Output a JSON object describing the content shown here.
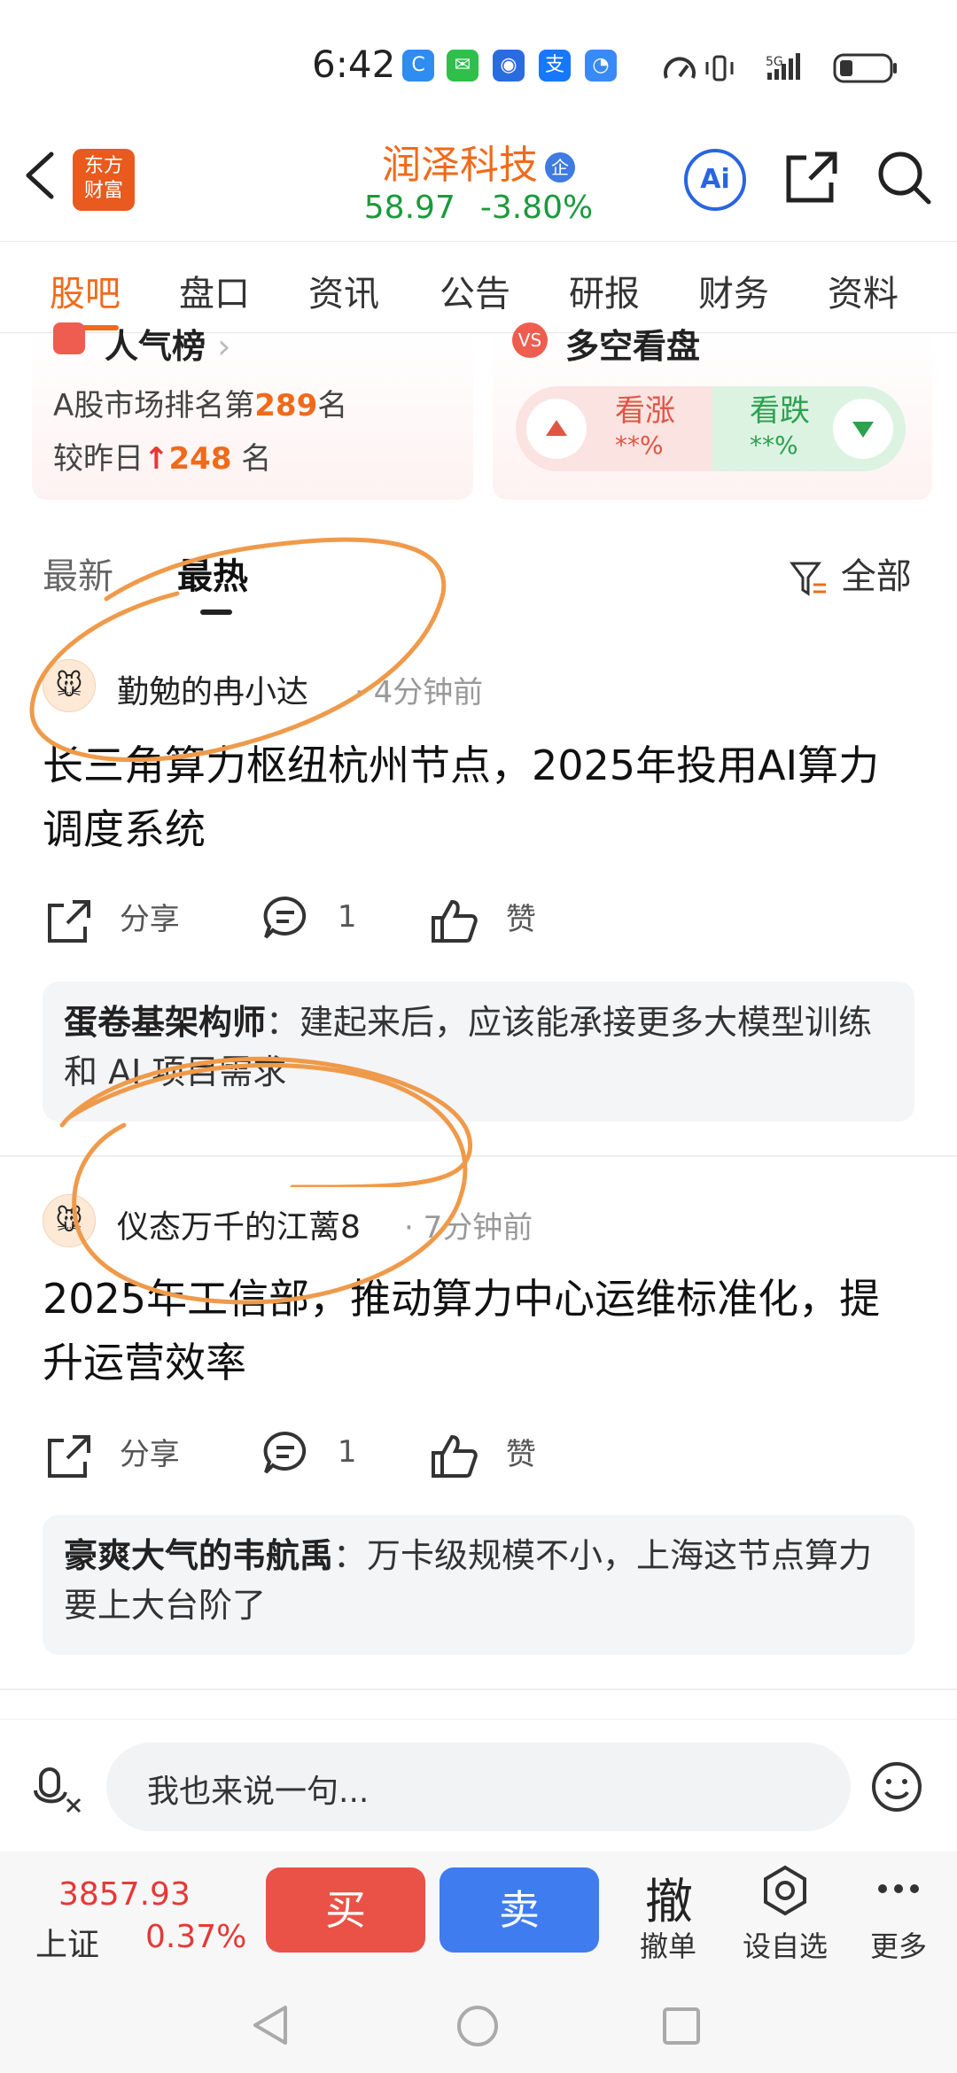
{
  "status_bar": {
    "time": "6:42",
    "icons": [
      "c-app-icon",
      "wechat-icon",
      "app-icon",
      "alipay-icon",
      "app-icon"
    ],
    "network": "5G"
  },
  "header": {
    "logo_line1": "东方",
    "logo_line2": "财富",
    "stock_name": "润泽科技",
    "badge": "企",
    "price": "58.97",
    "change": "-3.80%",
    "ai_label": "Ai"
  },
  "tabs": [
    "股吧",
    "盘口",
    "资讯",
    "公告",
    "研报",
    "财务",
    "资料"
  ],
  "popularity": {
    "title": "人气榜",
    "line1_prefix": "A股市场排名第",
    "rank": "289",
    "line1_suffix": "名",
    "line2_prefix": "较昨日",
    "change": "248",
    "line2_suffix": "名"
  },
  "sentiment": {
    "title": "多空看盘",
    "vs": "VS",
    "up_label": "看涨",
    "up_pct": "**%",
    "down_label": "看跌",
    "down_pct": "**%"
  },
  "sort": {
    "latest": "最新",
    "hottest": "最热",
    "filter": "全部"
  },
  "posts": [
    {
      "author": "勤勉的冉小达",
      "time": "· 4分钟前",
      "title": "长三角算力枢纽杭州节点，2025年投用AI算力调度系统",
      "share": "分享",
      "comments": "1",
      "like": "赞",
      "reply_user": "蛋卷基架构师",
      "reply_text": "：建起来后，应该能承接更多大模型训练和 AI 项目需求"
    },
    {
      "author": "仪态万千的江蓠8",
      "time": "· 7分钟前",
      "title": "2025年工信部，推动算力中心运维标准化，提升运营效率",
      "share": "分享",
      "comments": "1",
      "like": "赞",
      "reply_user": "豪爽大气的韦航禹",
      "reply_text": "：万卡级规模不小，上海这节点算力要上大台阶了"
    }
  ],
  "input": {
    "placeholder": "我也来说一句..."
  },
  "trade_bar": {
    "index_value": "3857.93",
    "index_name": "上证",
    "index_pct": "0.37%",
    "buy": "买",
    "sell": "卖",
    "cancel_big": "撤",
    "cancel_label": "撤单",
    "watch_label": "设自选",
    "more_label": "更多"
  },
  "colors": {
    "brand_orange": "#f06a1a",
    "down_green": "#1a9a3c",
    "up_red": "#e53935",
    "annotation": "#ef9a4a"
  }
}
